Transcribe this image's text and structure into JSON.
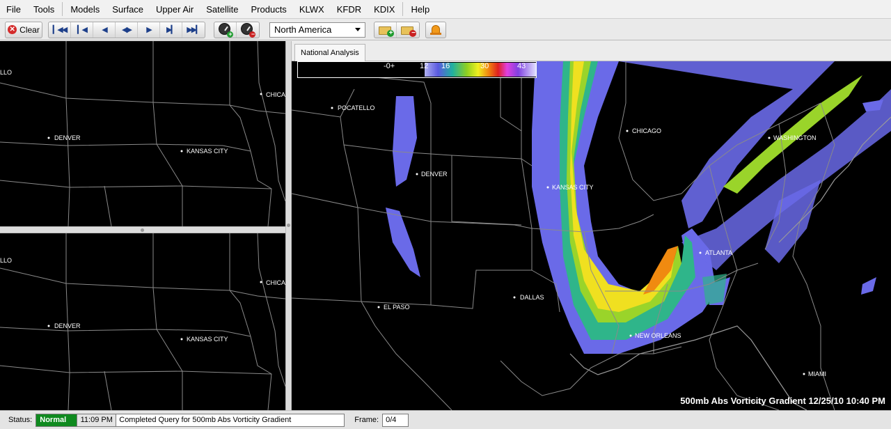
{
  "menu": [
    "File",
    "Tools",
    "Models",
    "Surface",
    "Upper Air",
    "Satellite",
    "Products",
    "KLWX",
    "KFDR",
    "KDIX",
    "Help"
  ],
  "toolbar": {
    "clear_label": "Clear",
    "frame_buttons": [
      "first-frame",
      "step-back",
      "back",
      "rock",
      "forward",
      "step-forward",
      "last-frame"
    ],
    "region": "North America"
  },
  "main": {
    "tab_label": "National Analysis",
    "colorbar": {
      "labels": [
        "-0+",
        "12",
        "16",
        "30",
        "43"
      ]
    },
    "product_label": "500mb Abs Vorticity Gradient 12/25/10 10:40 PM",
    "cities": [
      "POCATELLO",
      "DENVER",
      "CHICAGO",
      "WASHINGTON",
      "KANSAS CITY",
      "ATLANTA",
      "DALLAS",
      "EL PASO",
      "NEW ORLEANS",
      "MIAMI"
    ]
  },
  "left_top": {
    "cities": [
      "LLO",
      "DENVER",
      "KANSAS CITY",
      "CHICA"
    ]
  },
  "left_bottom": {
    "cities": [
      "LLO",
      "DENVER",
      "KANSAS CITY",
      "CHICA"
    ]
  },
  "status": {
    "label": "Status:",
    "state": "Normal",
    "time": "11:09 PM",
    "message": "Completed Query for 500mb Abs Vorticity Gradient",
    "frame_label": "Frame:",
    "frame_value": "0/4"
  },
  "colors": {
    "status_normal": "#0f8a1f",
    "map_bg": "#000000",
    "borders": "#8a8a8a"
  }
}
